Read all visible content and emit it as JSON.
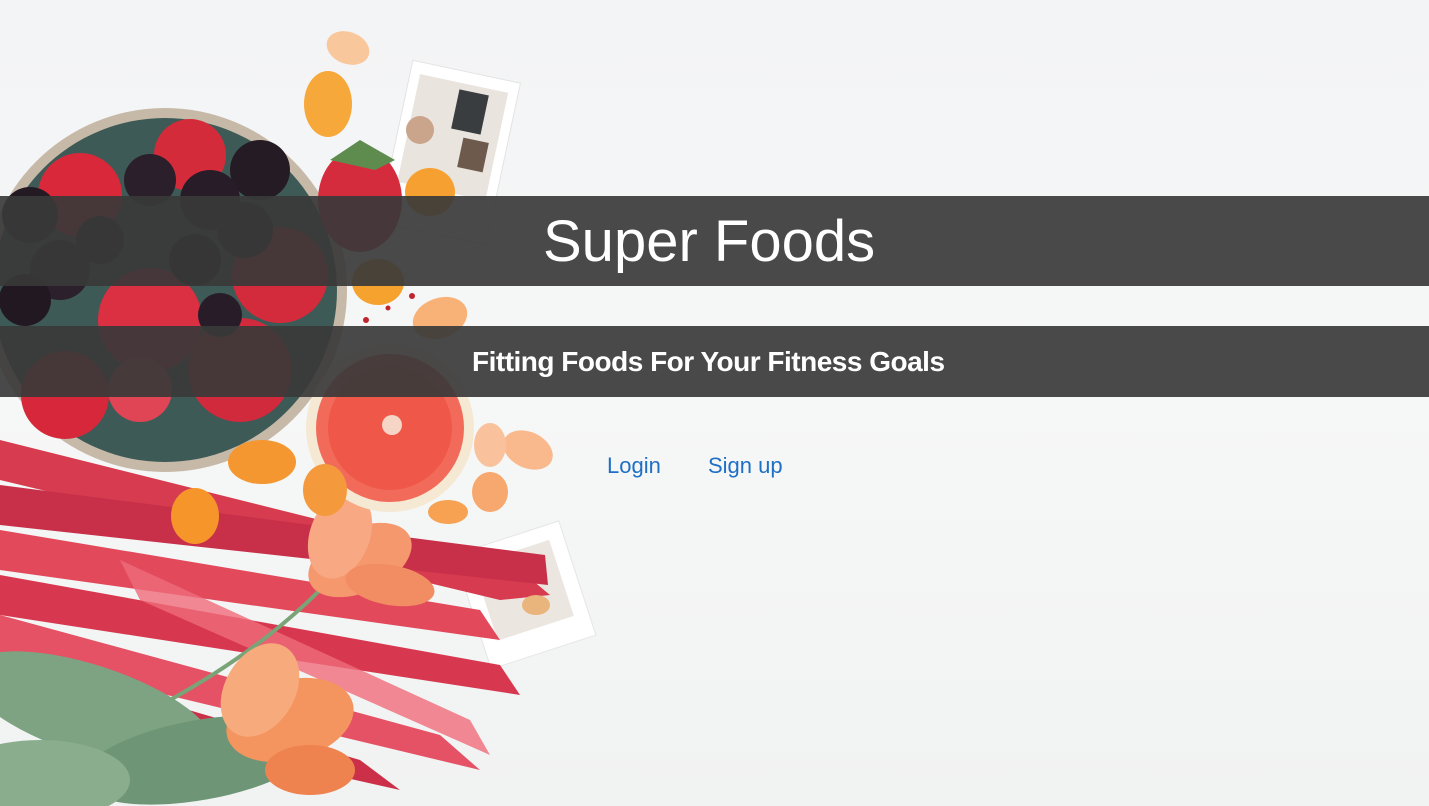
{
  "header": {
    "title": "Super Foods",
    "subtitle": "Fitting Foods For Your Fitness Goals"
  },
  "nav": {
    "login_label": "Login",
    "signup_label": "Sign up"
  },
  "colors": {
    "band": "#3a3a3a",
    "link": "#1f6fc5",
    "text": "#ffffff"
  }
}
